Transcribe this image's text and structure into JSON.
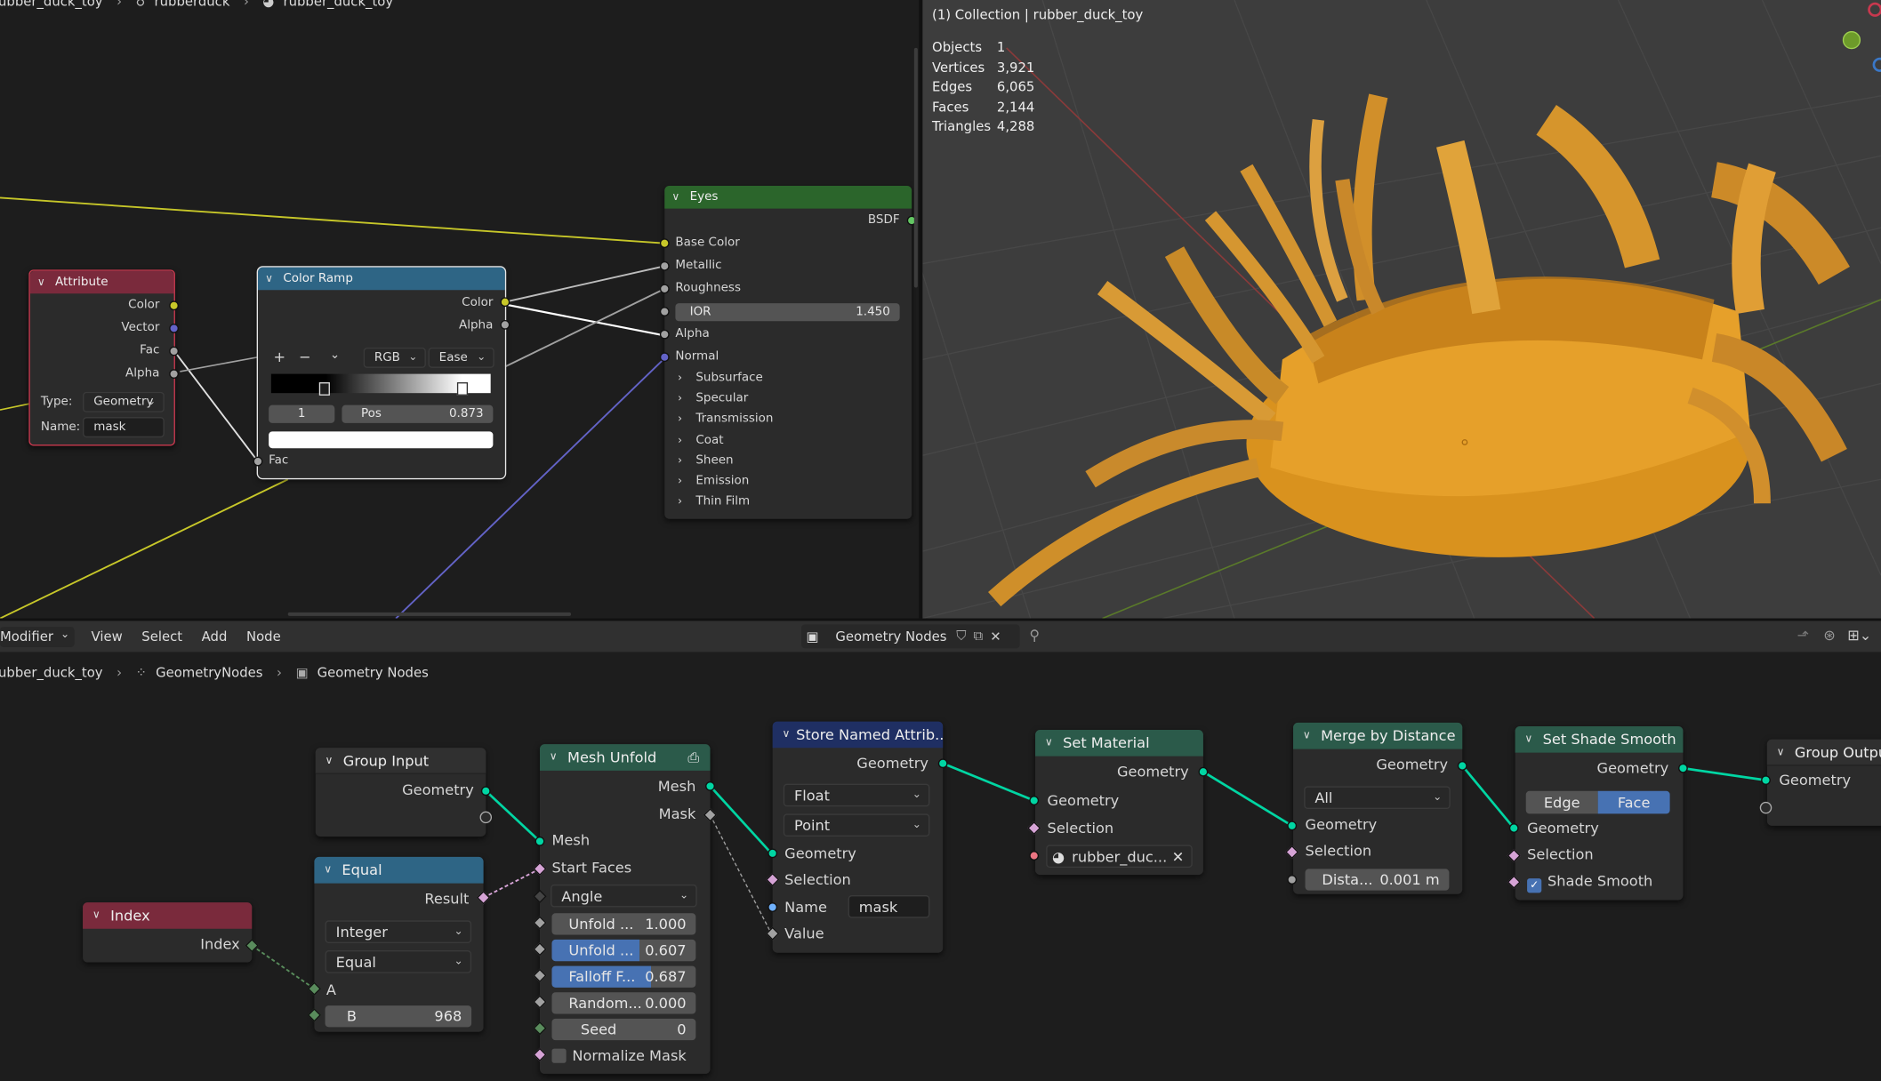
{
  "colors": {
    "accent": "#4772b3",
    "geo_socket": "#00d6a3",
    "shader_socket": "#63c763",
    "color_socket": "#c7c729",
    "float_socket": "#a1a1a1",
    "vector_socket": "#6363c7",
    "int_socket": "#598c5c"
  },
  "shader_editor": {
    "breadcrumb": [
      "rubber_duck_toy",
      "rubberduck",
      "rubber_duck_toy"
    ],
    "attribute": {
      "title": "Attribute",
      "outputs": [
        "Color",
        "Vector",
        "Fac",
        "Alpha"
      ],
      "type_label": "Type:",
      "type_value": "Geometry",
      "name_label": "Name:",
      "name_value": "mask"
    },
    "color_ramp": {
      "title": "Color Ramp",
      "outputs": [
        "Color",
        "Alpha"
      ],
      "add": "+",
      "remove": "−",
      "menu": "⌄",
      "mode": "RGB",
      "interp": "Ease",
      "index": "1",
      "pos_label": "Pos",
      "pos_value": "0.873",
      "input": "Fac"
    },
    "eyes": {
      "title": "Eyes",
      "output": "BSDF",
      "inputs": [
        "Base Color",
        "Metallic",
        "Roughness"
      ],
      "ior_label": "IOR",
      "ior_value": "1.450",
      "inputs2": [
        "Alpha",
        "Normal"
      ],
      "panels": [
        "Subsurface",
        "Specular",
        "Transmission",
        "Coat",
        "Sheen",
        "Emission",
        "Thin Film"
      ]
    }
  },
  "viewport": {
    "title": "(1) Collection | rubber_duck_toy",
    "stats": [
      [
        "Objects",
        "1"
      ],
      [
        "Vertices",
        "3,921"
      ],
      [
        "Edges",
        "6,065"
      ],
      [
        "Faces",
        "2,144"
      ],
      [
        "Triangles",
        "4,288"
      ]
    ]
  },
  "geo_editor": {
    "header": {
      "mode": "Modifier",
      "menus": [
        "View",
        "Select",
        "Add",
        "Node"
      ],
      "tree_name": "Geometry Nodes"
    },
    "breadcrumb": [
      "rubber_duck_toy",
      "GeometryNodes",
      "Geometry Nodes"
    ],
    "group_input": {
      "title": "Group Input",
      "output": "Geometry"
    },
    "index": {
      "title": "Index",
      "output": "Index"
    },
    "equal": {
      "title": "Equal",
      "output": "Result",
      "type": "Integer",
      "op": "Equal",
      "a": "A",
      "b_label": "B",
      "b_value": "968"
    },
    "mesh_unfold": {
      "title": "Mesh Unfold",
      "outputs": [
        "Mesh",
        "Mask"
      ],
      "inputs": [
        "Mesh",
        "Start Faces"
      ],
      "method": "Angle",
      "fields": [
        [
          "Unfold ...",
          "1.000",
          false
        ],
        [
          "Unfold ...",
          "0.607",
          true
        ],
        [
          "Falloff F...",
          "0.687",
          true
        ],
        [
          "Random...",
          "0.000",
          false
        ],
        [
          "Seed",
          "0",
          false
        ]
      ],
      "normalize": "Normalize Mask"
    },
    "store": {
      "title": "Store Named Attrib...",
      "output": "Geometry",
      "type": "Float",
      "domain": "Point",
      "inputs": [
        "Geometry",
        "Selection"
      ],
      "name_label": "Name",
      "name_value": "mask",
      "value": "Value"
    },
    "set_material": {
      "title": "Set Material",
      "output": "Geometry",
      "inputs": [
        "Geometry",
        "Selection"
      ],
      "material": "rubber_duc..."
    },
    "merge": {
      "title": "Merge by Distance",
      "output": "Geometry",
      "mode": "All",
      "inputs": [
        "Geometry",
        "Selection"
      ],
      "dist_label": "Dista...",
      "dist_value": "0.001 m"
    },
    "shade_smooth": {
      "title": "Set Shade Smooth",
      "output": "Geometry",
      "domain_edge": "Edge",
      "domain_face": "Face",
      "inputs": [
        "Geometry",
        "Selection"
      ],
      "smooth": "Shade Smooth"
    },
    "group_output": {
      "title": "Group Output",
      "input": "Geometry"
    }
  }
}
